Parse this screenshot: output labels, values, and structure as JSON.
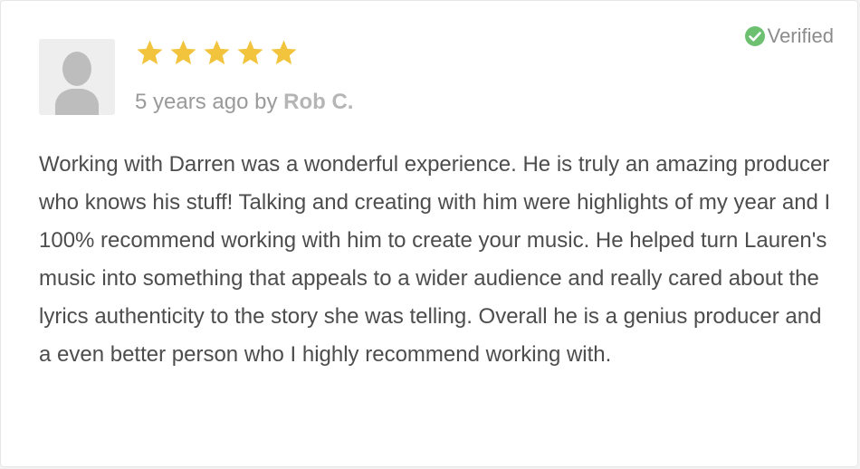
{
  "review": {
    "verified_label": "Verified",
    "rating": 5,
    "max_rating": 5,
    "time_ago": "5 years ago",
    "by_word": "by",
    "author": "Rob C.",
    "text": "Working with Darren was a wonderful experience. He is truly an amazing producer who knows his stuff! Talking and creating with him were highlights of my year and I 100% recommend working with him to create your music. He helped turn Lauren's music into something that appeals to a wider audience and really cared about the lyrics authenticity to the story she was telling. Overall he is a genius producer and a even better person who I highly recommend working with."
  },
  "icons": {
    "verified": "check-circle-icon",
    "avatar": "user-silhouette-icon",
    "star": "star-icon"
  },
  "colors": {
    "star": "#f2c43d",
    "verified_check": "#6cc070",
    "text": "#4d4d4d",
    "meta": "#9a9a9a",
    "avatar_bg": "#eeeeee",
    "avatar_figure": "#bdbdbd"
  }
}
